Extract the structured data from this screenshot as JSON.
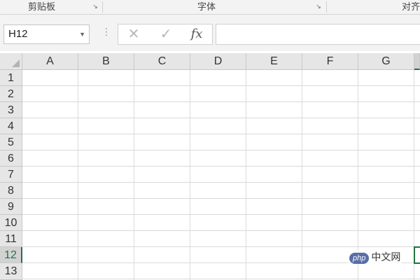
{
  "ribbon": {
    "groups": [
      {
        "label": "剪贴板"
      },
      {
        "label": "字体"
      },
      {
        "label": "对齐"
      }
    ]
  },
  "formula_bar": {
    "name_box": "H12",
    "cancel_icon": "close-icon",
    "enter_icon": "check-icon",
    "function_label": "fx",
    "formula_value": ""
  },
  "sheet": {
    "columns": [
      "A",
      "B",
      "C",
      "D",
      "E",
      "F",
      "G"
    ],
    "rows": [
      "1",
      "2",
      "3",
      "4",
      "5",
      "6",
      "7",
      "8",
      "9",
      "10",
      "11",
      "12",
      "13"
    ],
    "active_cell": "H12"
  },
  "watermark": {
    "badge": "php",
    "text": "中文网"
  },
  "colors": {
    "accent": "#217346",
    "header_bg": "#e6e6e6",
    "gridline": "#dadada"
  }
}
